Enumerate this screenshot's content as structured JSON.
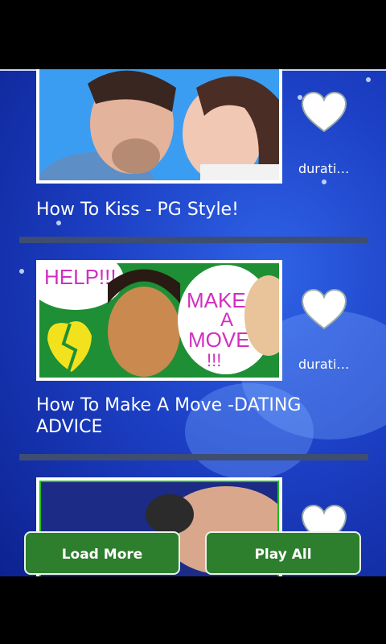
{
  "videos": [
    {
      "title": "How To Kiss - PG Style!",
      "duration": "durati…",
      "thumbnail": "kissing-couple-thumbnail"
    },
    {
      "title": "How To Make A Move -DATING ADVICE",
      "duration": "durati…",
      "thumbnail": "dating-advice-thumbnail",
      "thumb_texts": {
        "help": "HELP!!!",
        "make": "MAKE",
        "a": "A",
        "move": "MOVE",
        "bangs": "!!!"
      }
    },
    {
      "title": "",
      "duration": "",
      "thumbnail": "partial-thumbnail"
    }
  ],
  "buttons": {
    "load_more": "Load More",
    "play_all": "Play All"
  },
  "colors": {
    "button_green": "#2d7e2d",
    "background_blue": "#1c3fc4",
    "divider": "#3e4d72"
  }
}
